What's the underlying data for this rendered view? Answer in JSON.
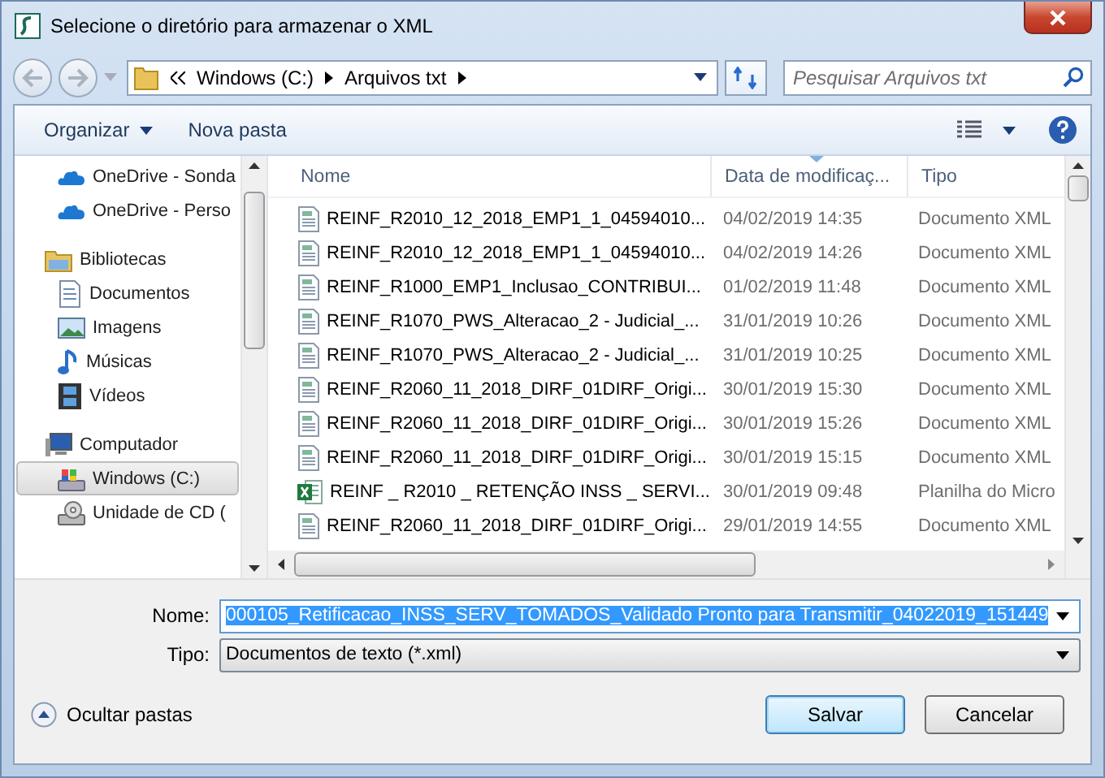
{
  "window": {
    "title": "Selecione o diretório para armazenar o XML"
  },
  "navigation": {
    "breadcrumb": [
      "Windows (C:)",
      "Arquivos txt"
    ],
    "search": {
      "placeholder": "Pesquisar Arquivos txt"
    }
  },
  "toolbar": {
    "organize": "Organizar",
    "new_folder": "Nova pasta"
  },
  "sidebar": {
    "groups": [
      {
        "items": [
          {
            "label": "OneDrive - Sonda",
            "kind": "cloud",
            "selected": false
          },
          {
            "label": "OneDrive - Perso",
            "kind": "cloud",
            "selected": false
          }
        ]
      },
      {
        "label": "Bibliotecas",
        "kind": "library",
        "items": [
          {
            "label": "Documentos",
            "kind": "document",
            "selected": false
          },
          {
            "label": "Imagens",
            "kind": "picture",
            "selected": false
          },
          {
            "label": "Músicas",
            "kind": "music",
            "selected": false
          },
          {
            "label": "Vídeos",
            "kind": "video",
            "selected": false
          }
        ]
      },
      {
        "label": "Computador",
        "kind": "computer",
        "items": [
          {
            "label": "Windows (C:)",
            "kind": "drive",
            "selected": true
          },
          {
            "label": "Unidade de CD (",
            "kind": "cd",
            "selected": false
          }
        ]
      }
    ]
  },
  "file_list": {
    "columns": [
      {
        "label": "Nome",
        "sorted": false
      },
      {
        "label": "Data de modificaç...",
        "sorted": true
      },
      {
        "label": "Tipo",
        "sorted": false
      }
    ],
    "rows": [
      {
        "name": "REINF_R2010_12_2018_EMP1_1_04594010...",
        "date": "04/02/2019 14:35",
        "type": "Documento XML",
        "kind": "xml"
      },
      {
        "name": "REINF_R2010_12_2018_EMP1_1_04594010...",
        "date": "04/02/2019 14:26",
        "type": "Documento XML",
        "kind": "xml"
      },
      {
        "name": "REINF_R1000_EMP1_Inclusao_CONTRIBUI...",
        "date": "01/02/2019 11:48",
        "type": "Documento XML",
        "kind": "xml"
      },
      {
        "name": "REINF_R1070_PWS_Alteracao_2 - Judicial_...",
        "date": "31/01/2019 10:26",
        "type": "Documento XML",
        "kind": "xml"
      },
      {
        "name": "REINF_R1070_PWS_Alteracao_2 - Judicial_...",
        "date": "31/01/2019 10:25",
        "type": "Documento XML",
        "kind": "xml"
      },
      {
        "name": "REINF_R2060_11_2018_DIRF_01DIRF_Origi...",
        "date": "30/01/2019 15:30",
        "type": "Documento XML",
        "kind": "xml"
      },
      {
        "name": "REINF_R2060_11_2018_DIRF_01DIRF_Origi...",
        "date": "30/01/2019 15:26",
        "type": "Documento XML",
        "kind": "xml"
      },
      {
        "name": "REINF_R2060_11_2018_DIRF_01DIRF_Origi...",
        "date": "30/01/2019 15:15",
        "type": "Documento XML",
        "kind": "xml"
      },
      {
        "name": "REINF _ R2010 _ RETENÇÃO INSS _ SERVI...",
        "date": "30/01/2019 09:48",
        "type": "Planilha do Micro",
        "kind": "excel"
      },
      {
        "name": "REINF_R2060_11_2018_DIRF_01DIRF_Origi...",
        "date": "29/01/2019 14:55",
        "type": "Documento XML",
        "kind": "xml"
      }
    ]
  },
  "form": {
    "name_label": "Nome:",
    "name_value": "000105_Retificacao_INSS_SERV_TOMADOS_Validado Pronto para Transmitir_04022019_151449",
    "type_label": "Tipo:",
    "type_value": "Documentos de texto (*.xml)"
  },
  "footer": {
    "hide_folders": "Ocultar pastas",
    "buttons": [
      {
        "label": "Salvar",
        "default": true
      },
      {
        "label": "Cancelar",
        "default": false
      }
    ]
  }
}
